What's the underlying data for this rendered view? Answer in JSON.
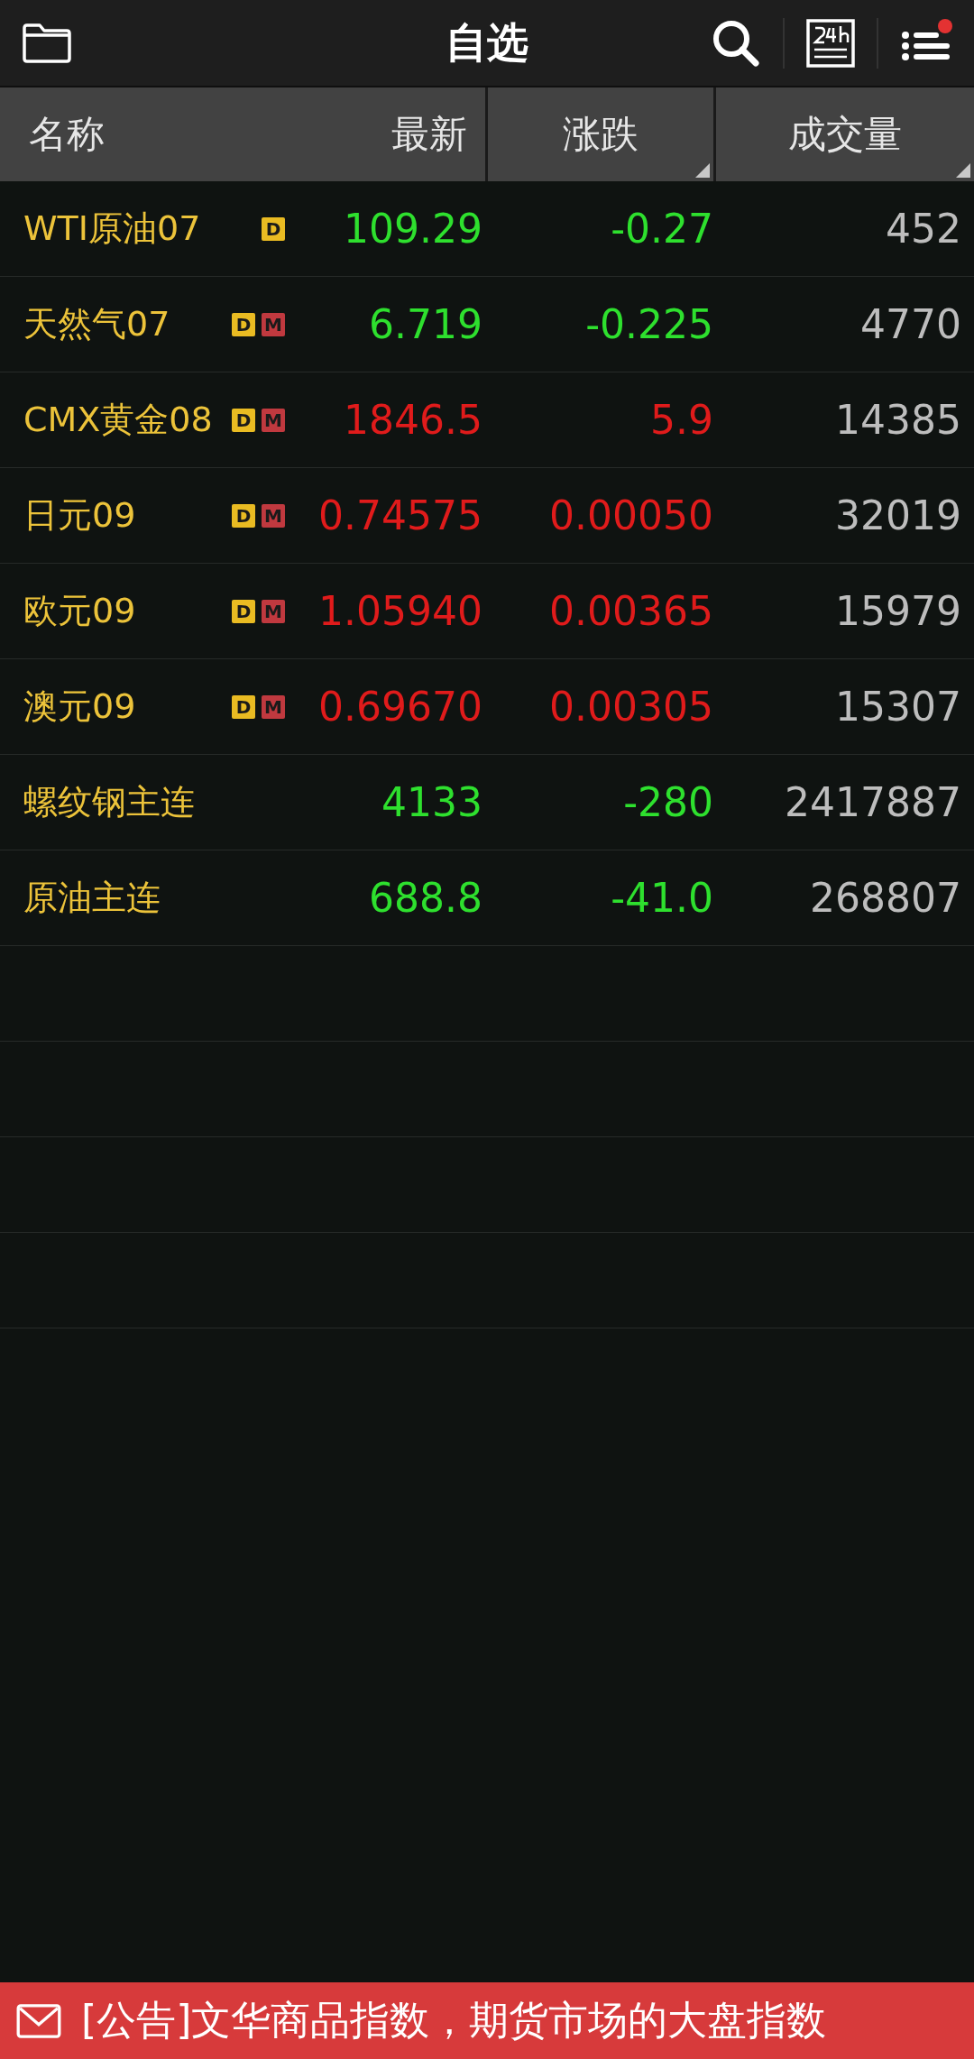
{
  "top_bar": {
    "title": "自选",
    "menu_badge": true
  },
  "columns": [
    {
      "label": "名称",
      "sortable": false
    },
    {
      "label": "最新",
      "sortable": false
    },
    {
      "label": "涨跌",
      "sortable": true
    },
    {
      "label": "成交量",
      "sortable": true
    }
  ],
  "rows": [
    {
      "name": "WTI原油07",
      "badges": [
        {
          "label": "D",
          "color": "#e9bb22"
        }
      ],
      "latest": "109.29",
      "change": "-0.27",
      "volume": "452",
      "rising": false
    },
    {
      "name": "天然气07",
      "badges": [
        {
          "label": "D",
          "color": "#e9bb22"
        },
        {
          "label": "M",
          "color": "#c0393f"
        }
      ],
      "latest": "6.719",
      "change": "-0.225",
      "volume": "4770",
      "rising": false
    },
    {
      "name": "CMX黄金08",
      "badges": [
        {
          "label": "D",
          "color": "#e9bb22"
        },
        {
          "label": "M",
          "color": "#c0393f"
        }
      ],
      "latest": "1846.5",
      "change": "5.9",
      "volume": "14385",
      "rising": true
    },
    {
      "name": "日元09",
      "badges": [
        {
          "label": "D",
          "color": "#e9bb22"
        },
        {
          "label": "M",
          "color": "#c0393f"
        }
      ],
      "latest": "0.74575",
      "change": "0.00050",
      "volume": "32019",
      "rising": true
    },
    {
      "name": "欧元09",
      "badges": [
        {
          "label": "D",
          "color": "#e9bb22"
        },
        {
          "label": "M",
          "color": "#c0393f"
        }
      ],
      "latest": "1.05940",
      "change": "0.00365",
      "volume": "15979",
      "rising": true
    },
    {
      "name": "澳元09",
      "badges": [
        {
          "label": "D",
          "color": "#e9bb22"
        },
        {
          "label": "M",
          "color": "#c0393f"
        }
      ],
      "latest": "0.69670",
      "change": "0.00305",
      "volume": "15307",
      "rising": true
    },
    {
      "name": "螺纹钢主连",
      "badges": [],
      "latest": "4133",
      "change": "-280",
      "volume": "2417887",
      "rising": false
    },
    {
      "name": "原油主连",
      "badges": [],
      "latest": "688.8",
      "change": "-41.0",
      "volume": "268807",
      "rising": false
    }
  ],
  "notice": {
    "text": "[公告]文华商品指数，期货市场的大盘指数"
  }
}
